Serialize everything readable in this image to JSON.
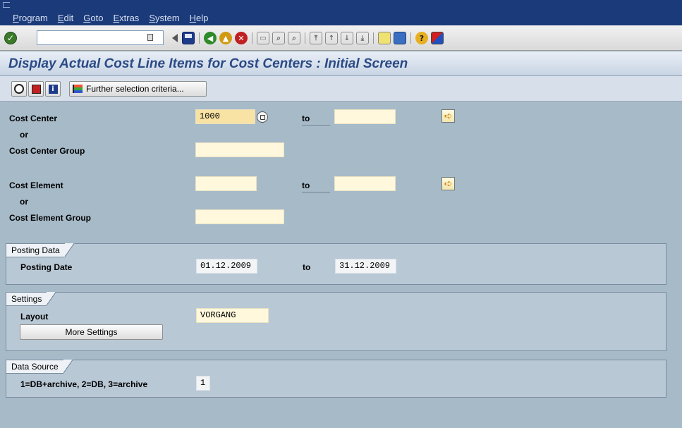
{
  "menu": [
    "Program",
    "Edit",
    "Goto",
    "Extras",
    "System",
    "Help"
  ],
  "toolbar": {
    "command_value": ""
  },
  "title": "Display Actual Cost Line Items for Cost Centers : Initial Screen",
  "app_toolbar": {
    "further_label": "Further selection criteria..."
  },
  "form": {
    "cost_center": {
      "label": "Cost Center",
      "from": "1000",
      "to_label": "to",
      "to": ""
    },
    "or1": "or",
    "cost_center_group": {
      "label": "Cost Center Group",
      "value": ""
    },
    "cost_element": {
      "label": "Cost Element",
      "from": "",
      "to_label": "to",
      "to": ""
    },
    "or2": "or",
    "cost_element_group": {
      "label": "Cost Element Group",
      "value": ""
    }
  },
  "posting": {
    "title": "Posting Data",
    "date_label": "Posting Date",
    "from": "01.12.2009",
    "to_label": "to",
    "to": "31.12.2009"
  },
  "settings": {
    "title": "Settings",
    "layout_label": "Layout",
    "layout_value": "VORGANG",
    "more_button": "More Settings"
  },
  "datasource": {
    "title": "Data Source",
    "label": "1=DB+archive, 2=DB, 3=archive",
    "value": "1"
  },
  "colors": {
    "background": "#a6bac8",
    "menubar": "#1b3a79",
    "title": "#2b4a86",
    "input": "#fff8dc",
    "input_focus": "#f8e2a4"
  }
}
